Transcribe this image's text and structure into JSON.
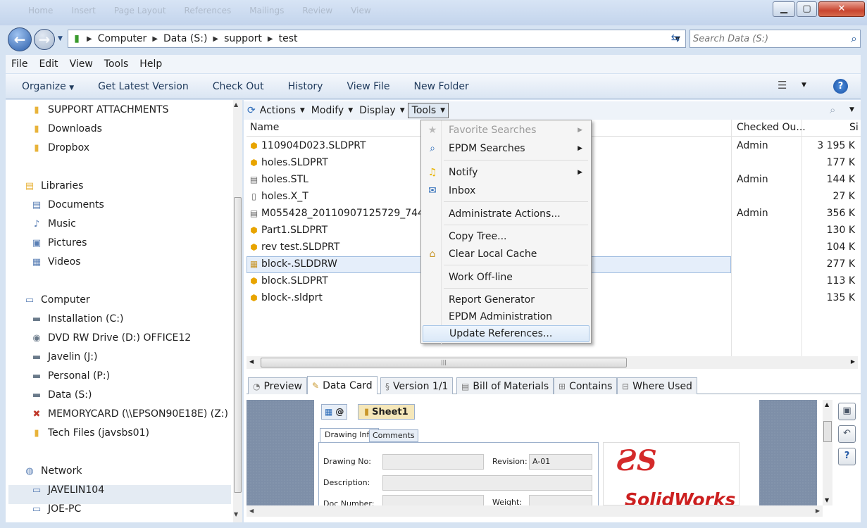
{
  "titlebar": {
    "faded_items": [
      "Home",
      "Insert",
      "Page Layout",
      "References",
      "Mailings",
      "Review",
      "View"
    ],
    "minimize": "▁",
    "maximize": "▢",
    "close": "✕"
  },
  "address": {
    "crumbs": [
      "Computer",
      "Data (S:)",
      "support",
      "test"
    ],
    "search_placeholder": "Search Data (S:)"
  },
  "menubar": [
    "File",
    "Edit",
    "View",
    "Tools",
    "Help"
  ],
  "commandbar": [
    "Organize",
    "Get Latest Version",
    "Check Out",
    "History",
    "View File",
    "New Folder"
  ],
  "nav": {
    "favorites": [
      "SUPPORT ATTACHMENTS",
      "Downloads",
      "Dropbox"
    ],
    "libraries_header": "Libraries",
    "libraries": [
      "Documents",
      "Music",
      "Pictures",
      "Videos"
    ],
    "computer_header": "Computer",
    "drives": [
      "Installation (C:)",
      "DVD RW Drive (D:) OFFICE12",
      "Javelin (J:)",
      "Personal (P:)",
      "Data (S:)",
      "MEMORYCARD (\\\\EPSON90E18E) (Z:)",
      "Tech Files (javsbs01)"
    ],
    "network_header": "Network",
    "network": [
      "JAVELIN104",
      "JOE-PC"
    ]
  },
  "pdm_toolbar": [
    "Actions",
    "Modify",
    "Display",
    "Tools"
  ],
  "list": {
    "columns": {
      "name": "Name",
      "checked_out": "Checked Ou...",
      "size": "Si"
    },
    "rows": [
      {
        "name": "110904D023.SLDPRT",
        "checked_out": "Admin",
        "size": "3 195 K",
        "icon": "part-icon"
      },
      {
        "name": "holes.SLDPRT",
        "checked_out": "",
        "size": "177 K",
        "icon": "part-icon"
      },
      {
        "name": "holes.STL",
        "checked_out": "Admin",
        "size": "144 K",
        "icon": "document-icon"
      },
      {
        "name": "holes.X_T",
        "checked_out": "",
        "size": "27 K",
        "icon": "blank-file-icon"
      },
      {
        "name": "M055428_20110907125729_74405",
        "checked_out": "Admin",
        "size": "356 K",
        "icon": "document-icon"
      },
      {
        "name": "Part1.SLDPRT",
        "checked_out": "",
        "size": "130 K",
        "icon": "part-icon"
      },
      {
        "name": "rev test.SLDPRT",
        "checked_out": "",
        "size": "104 K",
        "icon": "part-icon"
      },
      {
        "name": "block-.SLDDRW",
        "checked_out": "",
        "size": "277 K",
        "icon": "drawing-icon"
      },
      {
        "name": "block.SLDPRT",
        "checked_out": "",
        "size": "113 K",
        "icon": "part-icon"
      },
      {
        "name": "block-.sldprt",
        "checked_out": "",
        "size": "135 K",
        "icon": "part-icon"
      }
    ]
  },
  "tools_menu": {
    "favorite_searches": "Favorite Searches",
    "epdm_searches": "EPDM Searches",
    "notify": "Notify",
    "inbox": "Inbox",
    "administrate_actions": "Administrate Actions...",
    "copy_tree": "Copy Tree...",
    "clear_local_cache": "Clear Local Cache",
    "work_offline": "Work Off-line",
    "report_generator": "Report Generator",
    "epdm_administration": "EPDM Administration",
    "update_references": "Update References..."
  },
  "tabs": [
    "Preview",
    "Data Card",
    "Version 1/1",
    "Bill of Materials",
    "Contains",
    "Where Used"
  ],
  "datacard": {
    "at_tab": "@",
    "sheet_tab": "Sheet1",
    "subtab_info": "Drawing Info",
    "subtab_comments": "Comments",
    "labels": {
      "drawing_no": "Drawing No:",
      "revision": "Revision:",
      "description": "Description:",
      "doc_number": "Doc Number:",
      "weight": "Weight:"
    },
    "revision_value": "A-01",
    "logo_text": "SolidWorks"
  }
}
